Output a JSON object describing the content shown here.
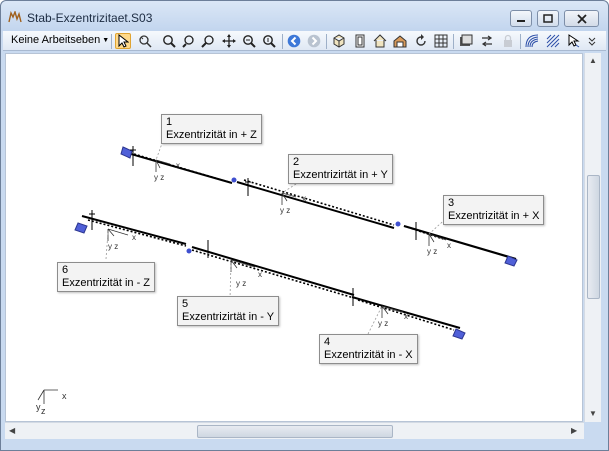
{
  "window": {
    "title": "Stab-Exzentrizitaet.S03"
  },
  "toolbar": {
    "workplane_label": "Keine Arbeitseben",
    "icons": [
      "select-arrow-icon",
      "rotate-view-icon",
      "zoom-icon",
      "zoom-window-icon",
      "zoom-in-icon",
      "pan-icon",
      "zoom-all-icon",
      "zoom-previous-icon",
      "back-icon",
      "forward-icon",
      "iso-view-icon",
      "front-view-icon",
      "home-view-icon",
      "side-view-icon",
      "refresh-icon",
      "grid-icon",
      "render-icon",
      "flip-icon",
      "lock-icon",
      "wave-icon",
      "hatch-icon",
      "cursor-filter-icon"
    ]
  },
  "callouts": [
    {
      "num": "1",
      "text": "Exzentrizität in + Z"
    },
    {
      "num": "2",
      "text": "Exzentrizirtät in + Y"
    },
    {
      "num": "3",
      "text": "Exzentrizität in + X"
    },
    {
      "num": "4",
      "text": "Exzentrizität in - X"
    },
    {
      "num": "5",
      "text": "Exzentrizirtät in - Y"
    },
    {
      "num": "6",
      "text": "Exzentrizität in - Z"
    }
  ],
  "axis_labels": {
    "y": "y",
    "z": "z",
    "x": "x"
  },
  "colors": {
    "member": "#000000",
    "support": "#5060d8",
    "leader": "#9a9a9a"
  }
}
